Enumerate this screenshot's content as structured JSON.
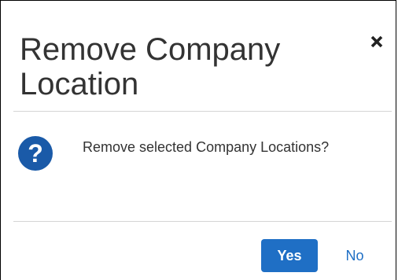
{
  "dialog": {
    "title": "Remove Company Location",
    "close_icon": "close-icon",
    "message": "Remove selected Company Locations?",
    "message_icon": "question-icon",
    "yes_label": "Yes",
    "no_label": "No"
  },
  "colors": {
    "primary": "#1f6fc5",
    "icon": "#1a5aa8",
    "divider": "#d5d5d5",
    "text": "#333333"
  }
}
